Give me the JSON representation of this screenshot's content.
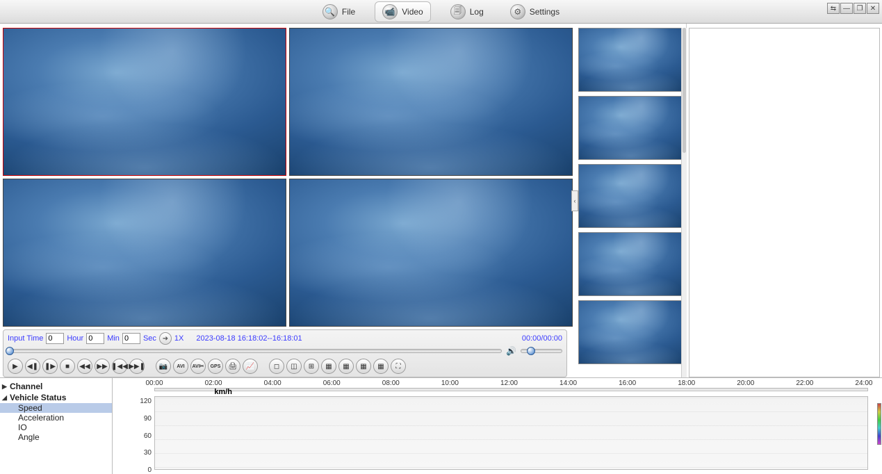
{
  "topbar": {
    "tabs": [
      {
        "id": "file",
        "label": "File",
        "icon": "search-icon"
      },
      {
        "id": "video",
        "label": "Video",
        "icon": "camera-icon",
        "active": true
      },
      {
        "id": "log",
        "label": "Log",
        "icon": "log-icon"
      },
      {
        "id": "settings",
        "label": "Settings",
        "icon": "gear-icon"
      }
    ]
  },
  "playback": {
    "inputTimeLabel": "Input Time",
    "hourLabel": "Hour",
    "minLabel": "Min",
    "secLabel": "Sec",
    "hourValue": "0",
    "minValue": "0",
    "secValue": "0",
    "speed": "1X",
    "range": "2023-08-18 16:18:02--16:18:01",
    "elapsed": "00:00/00:00",
    "buttons": [
      {
        "name": "play-button",
        "glyph": "▶"
      },
      {
        "name": "step-back-button",
        "glyph": "◀❚"
      },
      {
        "name": "step-forward-button",
        "glyph": "❚▶"
      },
      {
        "name": "stop-button",
        "glyph": "■"
      },
      {
        "name": "rewind-button",
        "glyph": "◀◀"
      },
      {
        "name": "forward-button",
        "glyph": "▶▶"
      },
      {
        "name": "prev-clip-button",
        "glyph": "❚◀◀"
      },
      {
        "name": "next-clip-button",
        "glyph": "▶▶❚"
      }
    ],
    "tools": [
      {
        "name": "snapshot-button",
        "glyph": "📷"
      },
      {
        "name": "avi-button",
        "glyph": "AVI",
        "text": true
      },
      {
        "name": "cut-button",
        "glyph": "AVI✂",
        "text": true
      },
      {
        "name": "gps-button",
        "glyph": "GPS",
        "text": true
      },
      {
        "name": "print-button",
        "glyph": "🖨"
      },
      {
        "name": "chart-button",
        "glyph": "📈"
      }
    ],
    "layouts": [
      {
        "name": "layout-1-button",
        "glyph": "◻"
      },
      {
        "name": "layout-2-button",
        "glyph": "◫"
      },
      {
        "name": "layout-4-button",
        "glyph": "⊞"
      },
      {
        "name": "layout-6-button",
        "glyph": "▦"
      },
      {
        "name": "layout-8-button",
        "glyph": "▦"
      },
      {
        "name": "layout-9-button",
        "glyph": "▦"
      },
      {
        "name": "layout-16-button",
        "glyph": "▦"
      },
      {
        "name": "fullscreen-button",
        "glyph": "⛶"
      }
    ]
  },
  "tree": {
    "channelLabel": "Channel",
    "vehicleStatusLabel": "Vehicle Status",
    "items": [
      {
        "label": "Speed",
        "selected": true
      },
      {
        "label": "Acceleration"
      },
      {
        "label": "IO"
      },
      {
        "label": "Angle"
      }
    ]
  },
  "chart_data": {
    "type": "line",
    "title": "",
    "xlabel": "",
    "ylabel": "km/h",
    "x_ticks": [
      "00:00",
      "02:00",
      "04:00",
      "06:00",
      "08:00",
      "10:00",
      "12:00",
      "14:00",
      "16:00",
      "18:00",
      "20:00",
      "22:00",
      "24:00"
    ],
    "y_ticks": [
      0,
      30,
      60,
      90,
      120
    ],
    "ylim": [
      0,
      130
    ],
    "series": [
      {
        "name": "Speed",
        "values": []
      }
    ]
  }
}
